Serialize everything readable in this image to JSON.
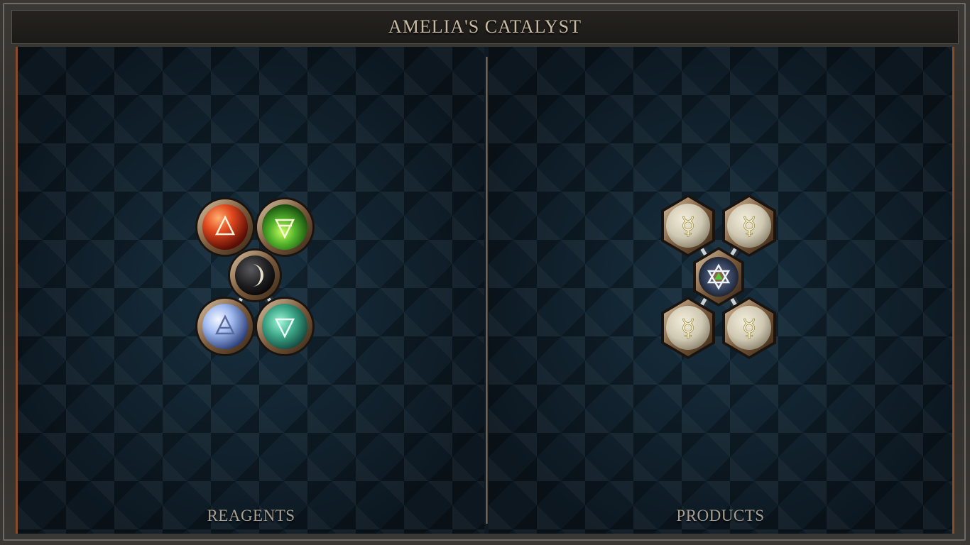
{
  "title": "AMELIA'S CATALYST",
  "reagents": {
    "label": "REAGENTS",
    "center_orb": {
      "icon": "moon-symbol-icon",
      "symbol": "☽",
      "color": "#1f1f22"
    },
    "orbs": [
      {
        "icon": "fire-triangle-icon",
        "color": "#e0481e"
      },
      {
        "icon": "earth-triangle-icon",
        "color": "#4fb02a"
      },
      {
        "icon": "air-triangle-icon",
        "color": "#9fb9f0"
      },
      {
        "icon": "water-triangle-icon",
        "color": "#3fa98a"
      }
    ]
  },
  "products": {
    "label": "PRODUCTS",
    "center_orb": {
      "icon": "hexagram-icon",
      "color": "#2b2a2d"
    },
    "orbs": [
      {
        "icon": "mercury-symbol-icon",
        "symbol": "☿",
        "color": "#cfc8b2"
      },
      {
        "icon": "mercury-symbol-icon",
        "symbol": "☿",
        "color": "#cfc8b2"
      },
      {
        "icon": "mercury-symbol-icon",
        "symbol": "☿",
        "color": "#cfc8b2"
      },
      {
        "icon": "mercury-symbol-icon",
        "symbol": "☿",
        "color": "#cfc8b2"
      }
    ]
  }
}
